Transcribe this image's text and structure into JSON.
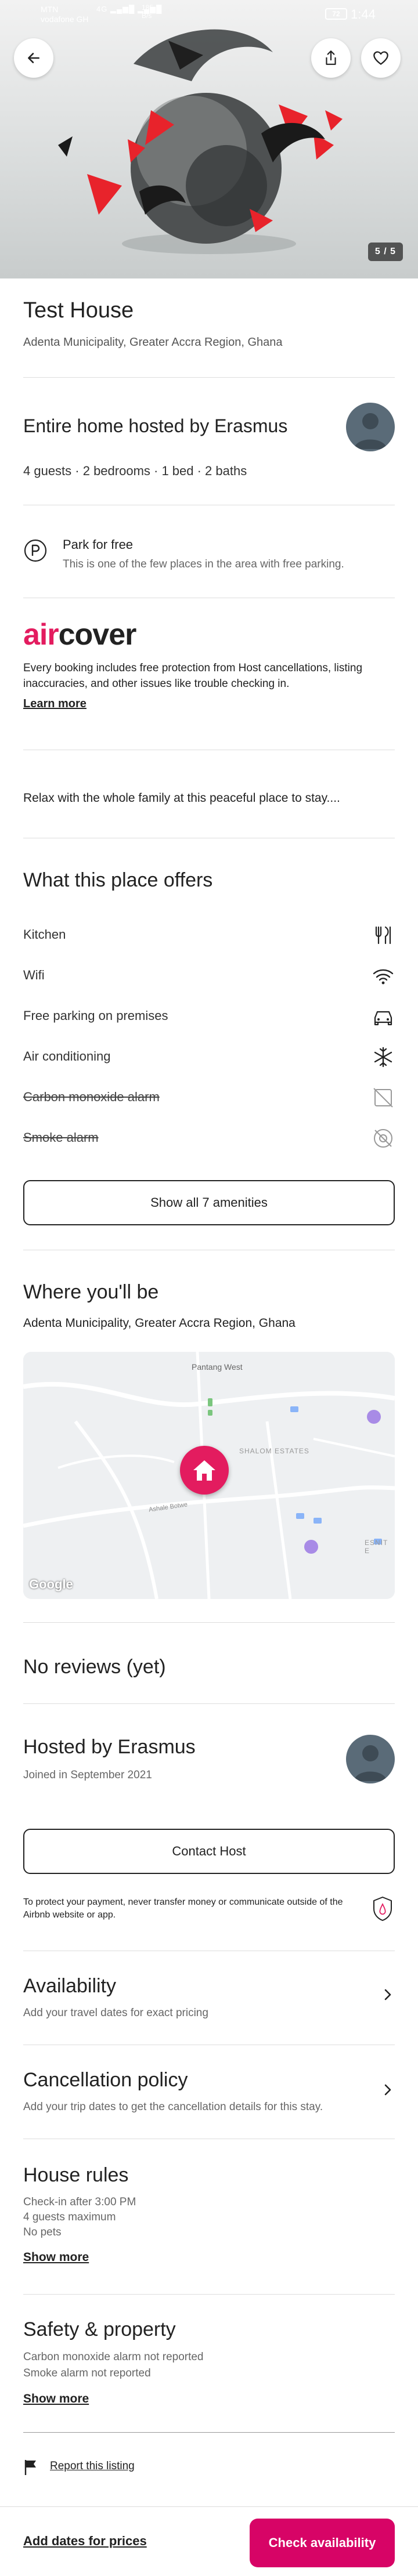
{
  "status_bar": {
    "carrier_line1": "MTN",
    "carrier_line2": "vodafone GH",
    "signal_text": "4G ▂▄▆█ ▂▄▆█",
    "speed_value": "185",
    "speed_unit": "B/s",
    "battery": "72",
    "time": "1:44"
  },
  "hero": {
    "photo_counter": "5 / 5",
    "back_icon": "arrow-left-icon",
    "share_icon": "share-icon",
    "wishlist_icon": "heart-icon"
  },
  "listing": {
    "title": "Test House",
    "location": "Adenta Municipality, Greater Accra Region, Ghana"
  },
  "host_summary": {
    "heading": "Entire home hosted by Erasmus",
    "details": "4 guests · 2 bedrooms · 1 bed · 2 baths"
  },
  "highlight": {
    "title": "Park for free",
    "description": "This is one of the few places in the area with free parking.",
    "icon": "parking-icon"
  },
  "aircover": {
    "logo_air": "air",
    "logo_cover": "cover",
    "description": "Every booking includes free protection from Host cancellations, listing inaccuracies, and other issues like trouble checking in.",
    "learn_more": "Learn more"
  },
  "description": "Relax with the whole family at this peaceful place to stay....",
  "amenities": {
    "heading": "What this place offers",
    "items": [
      {
        "label": "Kitchen",
        "icon": "kitchen-icon",
        "available": true
      },
      {
        "label": "Wifi",
        "icon": "wifi-icon",
        "available": true
      },
      {
        "label": "Free parking on premises",
        "icon": "car-icon",
        "available": true
      },
      {
        "label": "Air conditioning",
        "icon": "snowflake-icon",
        "available": true
      },
      {
        "label": "Carbon monoxide alarm",
        "icon": "co-alarm-icon",
        "available": false
      },
      {
        "label": "Smoke alarm",
        "icon": "smoke-alarm-icon",
        "available": false
      }
    ],
    "show_all": "Show all 7 amenities"
  },
  "location": {
    "heading": "Where you'll be",
    "address": "Adenta Municipality, Greater Accra Region, Ghana",
    "map_labels": {
      "area1": "Pantang West",
      "area2": "SHALOM ESTATES",
      "area3": "ESNIT E",
      "road": "Ashale Botwe"
    },
    "map_attribution": "Google"
  },
  "reviews": {
    "heading": "No reviews (yet)"
  },
  "host": {
    "heading": "Hosted by Erasmus",
    "joined": "Joined in September 2021",
    "contact": "Contact Host",
    "warning": "To protect your payment, never transfer money or communicate outside of the Airbnb website or app."
  },
  "availability": {
    "heading": "Availability",
    "sub": "Add your travel dates for exact pricing"
  },
  "cancellation": {
    "heading": "Cancellation policy",
    "sub": "Add your trip dates to get the cancellation details for this stay."
  },
  "house_rules": {
    "heading": "House rules",
    "lines": [
      "Check-in after 3:00 PM",
      "4 guests maximum",
      "No pets"
    ],
    "show_more": "Show more"
  },
  "safety": {
    "heading": "Safety & property",
    "lines": [
      "Carbon monoxide alarm not reported",
      "Smoke alarm not reported"
    ],
    "show_more": "Show more"
  },
  "report": {
    "label": "Report this listing",
    "icon": "flag-icon"
  },
  "footer": {
    "dates_prompt": "Add dates for prices",
    "cta": "Check availability"
  },
  "colors": {
    "brand": "#FF385C",
    "cta": "#D70466",
    "text": "#222222"
  }
}
